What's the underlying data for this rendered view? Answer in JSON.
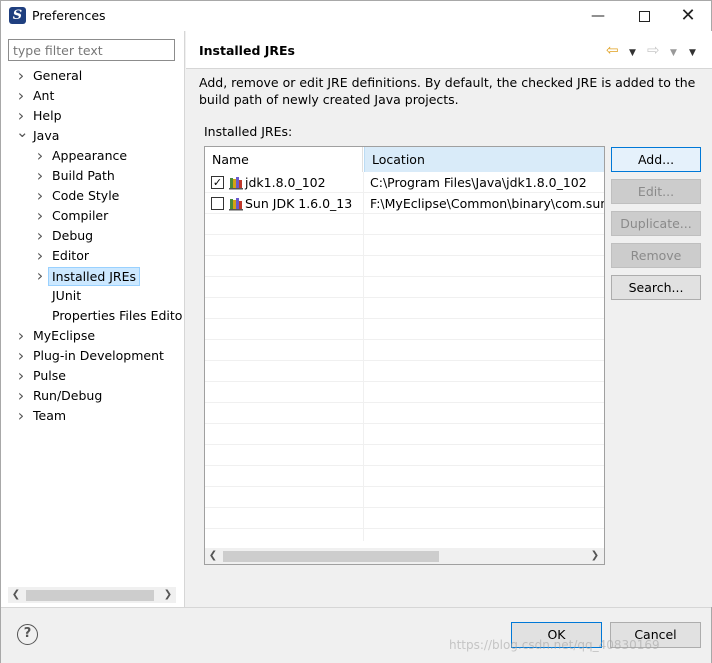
{
  "window": {
    "title": "Preferences",
    "minimize_glyph": "—",
    "close_glyph": "✕"
  },
  "sidebar": {
    "filter_placeholder": "type filter text",
    "items": [
      {
        "label": "General",
        "expandable": true,
        "expanded": false,
        "level": 0
      },
      {
        "label": "Ant",
        "expandable": true,
        "expanded": false,
        "level": 0
      },
      {
        "label": "Help",
        "expandable": true,
        "expanded": false,
        "level": 0
      },
      {
        "label": "Java",
        "expandable": true,
        "expanded": true,
        "level": 0
      },
      {
        "label": "Appearance",
        "expandable": true,
        "expanded": false,
        "level": 1
      },
      {
        "label": "Build Path",
        "expandable": true,
        "expanded": false,
        "level": 1
      },
      {
        "label": "Code Style",
        "expandable": true,
        "expanded": false,
        "level": 1
      },
      {
        "label": "Compiler",
        "expandable": true,
        "expanded": false,
        "level": 1
      },
      {
        "label": "Debug",
        "expandable": true,
        "expanded": false,
        "level": 1
      },
      {
        "label": "Editor",
        "expandable": true,
        "expanded": false,
        "level": 1
      },
      {
        "label": "Installed JREs",
        "expandable": true,
        "expanded": false,
        "level": 1,
        "selected": true
      },
      {
        "label": "JUnit",
        "expandable": false,
        "expanded": false,
        "level": 1
      },
      {
        "label": "Properties Files Edito",
        "expandable": false,
        "expanded": false,
        "level": 1
      },
      {
        "label": "MyEclipse",
        "expandable": true,
        "expanded": false,
        "level": 0
      },
      {
        "label": "Plug-in Development",
        "expandable": true,
        "expanded": false,
        "level": 0
      },
      {
        "label": "Pulse",
        "expandable": true,
        "expanded": false,
        "level": 0
      },
      {
        "label": "Run/Debug",
        "expandable": true,
        "expanded": false,
        "level": 0
      },
      {
        "label": "Team",
        "expandable": true,
        "expanded": false,
        "level": 0
      }
    ]
  },
  "page": {
    "title": "Installed JREs",
    "description": "Add, remove or edit JRE definitions. By default, the checked JRE is added to the build path of newly created Java projects.",
    "list_label": "Installed JREs:",
    "columns": [
      "Name",
      "Location"
    ],
    "rows": [
      {
        "checked": true,
        "name": "jdk1.8.0_102",
        "location": "C:\\Program Files\\Java\\jdk1.8.0_102"
      },
      {
        "checked": false,
        "name": "Sun JDK 1.6.0_13",
        "location": "F:\\MyEclipse\\Common\\binary\\com.sun.ja"
      }
    ],
    "buttons": [
      {
        "label": "Add...",
        "enabled": true
      },
      {
        "label": "Edit...",
        "enabled": false
      },
      {
        "label": "Duplicate...",
        "enabled": false
      },
      {
        "label": "Remove",
        "enabled": false
      },
      {
        "label": "Search...",
        "enabled": true
      }
    ]
  },
  "footer": {
    "help_glyph": "?",
    "ok_label": "OK",
    "cancel_label": "Cancel",
    "watermark": "https://blog.csdn.net/qq_40830169"
  },
  "colors": {
    "selection": "#cce8ff",
    "focus_border": "#0078d7",
    "back_arrow": "#e0a020"
  }
}
